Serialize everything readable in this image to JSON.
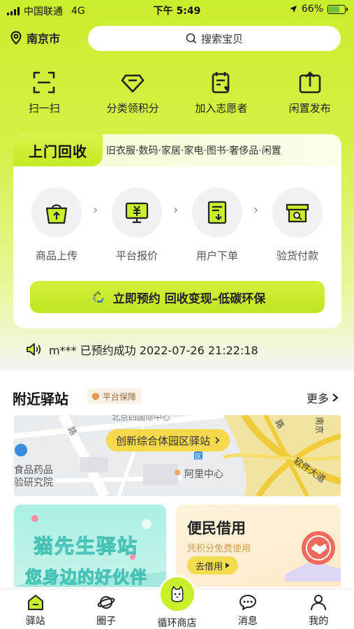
{
  "colors": {
    "accent": "#c9ee2c",
    "button": "#c5ea22",
    "badge_text": "#9a6a3c",
    "tag_yellow": "#f6d84c"
  },
  "status_bar": {
    "carrier": "中国联通",
    "network": "4G",
    "time": "下午 5:49",
    "battery": "66%",
    "battery_level": 0.66
  },
  "header": {
    "city": "南京市",
    "search_placeholder": "搜索宝贝"
  },
  "quick_actions": [
    {
      "label": "扫一扫",
      "icon": "scan-icon"
    },
    {
      "label": "分类领积分",
      "icon": "diamond-icon"
    },
    {
      "label": "加入志愿者",
      "icon": "calendar-heart-icon"
    },
    {
      "label": "闲置发布",
      "icon": "upload-icon"
    }
  ],
  "recycle": {
    "title": "上门回收",
    "categories": "旧衣服·数码·家居·家电·图书·奢侈品·闲置",
    "steps": [
      {
        "label": "商品上传",
        "icon": "bag-upload-icon"
      },
      {
        "label": "平台报价",
        "icon": "monitor-yuan-icon"
      },
      {
        "label": "用户下单",
        "icon": "order-icon"
      },
      {
        "label": "验货付款",
        "icon": "inspect-box-icon"
      }
    ],
    "button_label": "立即预约 回收变现–低碳环保"
  },
  "notice": {
    "text": "m*** 已预约成功 2022-07-26 21:22:18"
  },
  "nearby": {
    "title": "附近驿站",
    "badge": "平台保障",
    "more": "更多",
    "map": {
      "station_label": "创新综合体园区驿站",
      "place1": "阿里中心",
      "place2": "食品药品",
      "place3": "验研究院",
      "road": "软件大道",
      "road2": "路",
      "road3": "南京",
      "road4": "路",
      "poi_badge": "区",
      "top_text": "北京四国际中心"
    }
  },
  "promos": {
    "left": {
      "line1": "猫先生驿站",
      "line2": "您身边的好伙伴"
    },
    "right": {
      "title": "便民借用",
      "subtitle": "凭积分免费使用",
      "button": "去借用"
    }
  },
  "tabbar": [
    {
      "label": "驿站",
      "icon": "home-icon"
    },
    {
      "label": "圈子",
      "icon": "planet-icon"
    },
    {
      "label": "循环商店",
      "icon": "cat-logo-icon"
    },
    {
      "label": "消息",
      "icon": "chat-icon"
    },
    {
      "label": "我的",
      "icon": "person-icon"
    }
  ]
}
